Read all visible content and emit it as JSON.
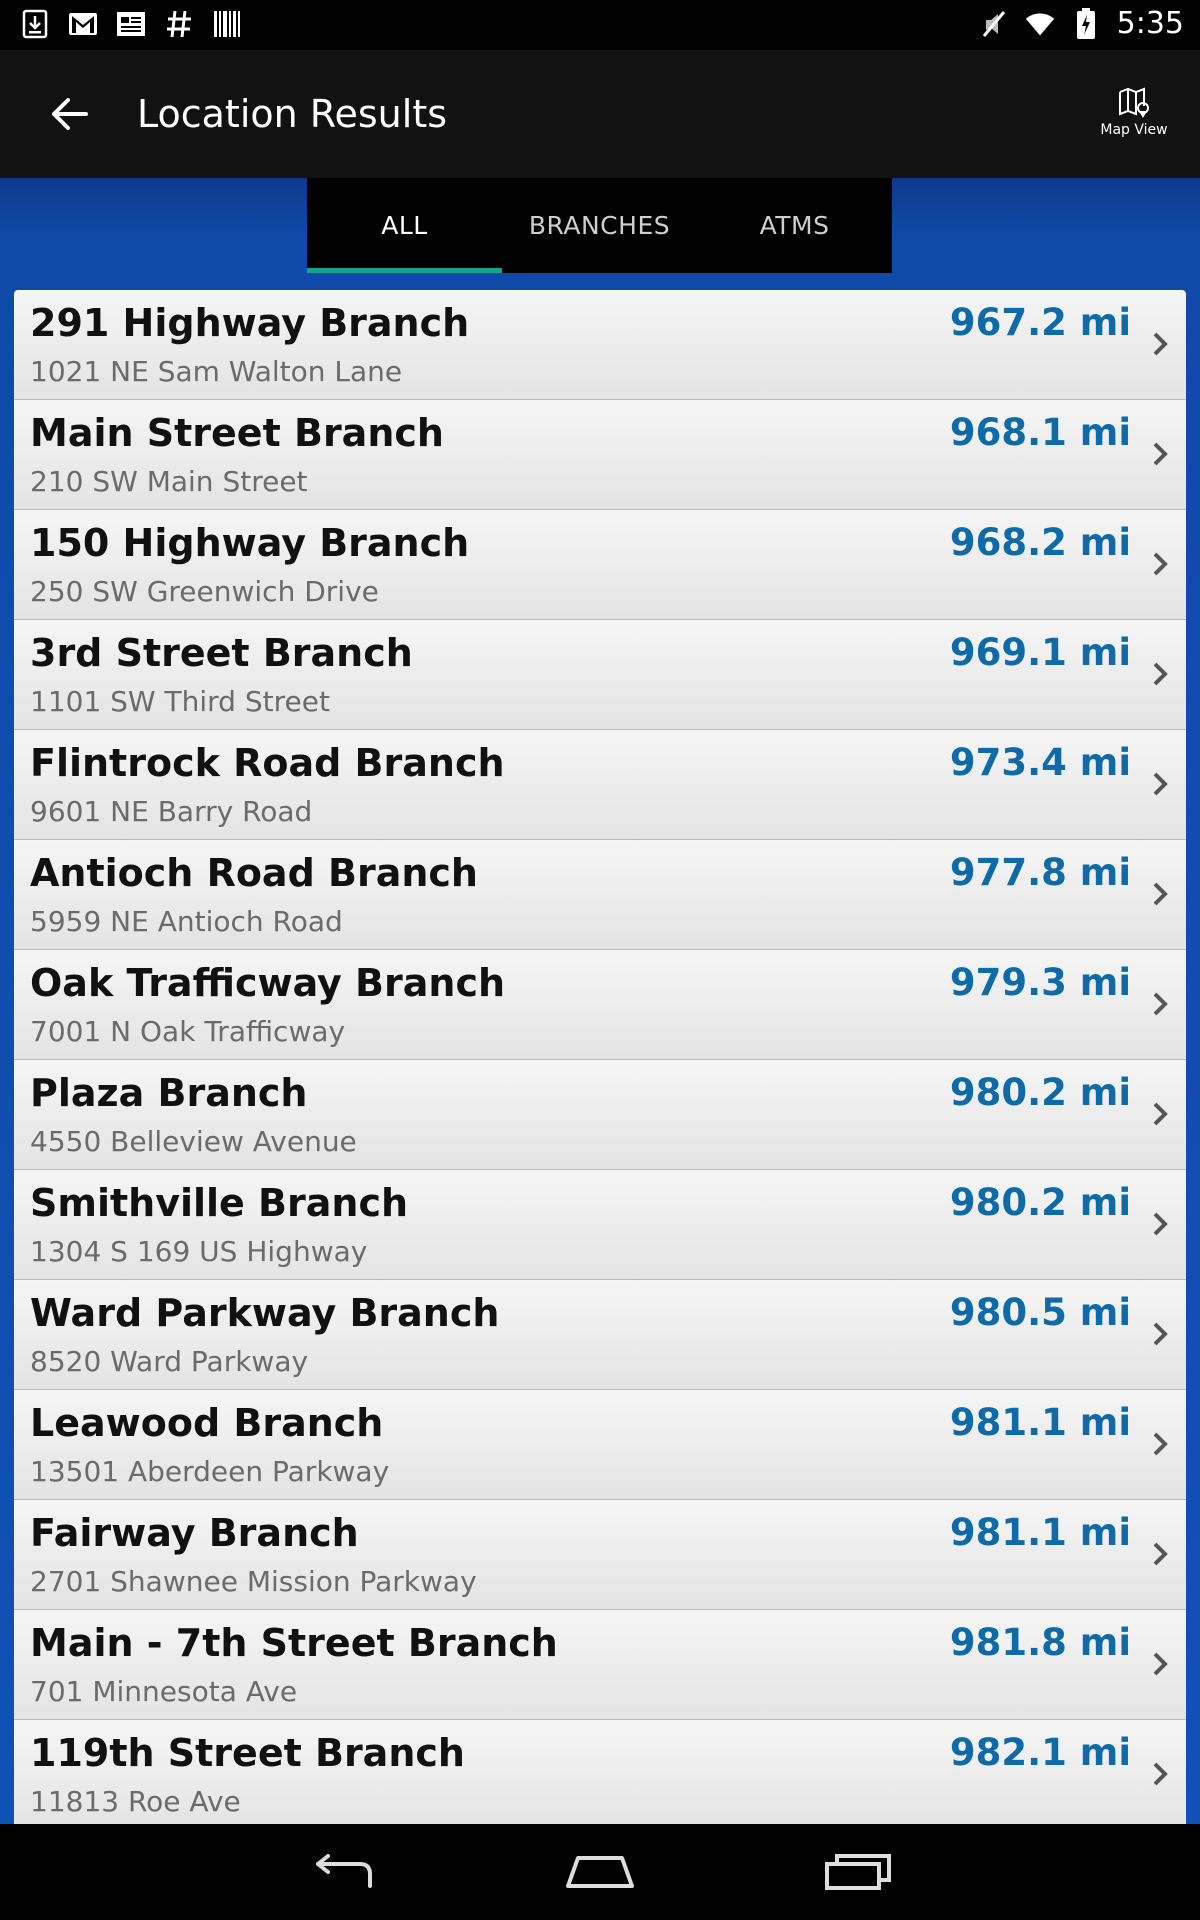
{
  "status_bar": {
    "left_icons": [
      "download-icon",
      "gmail-icon",
      "news-icon",
      "hash-icon",
      "barcode-icon"
    ],
    "right_icons": [
      "mute-icon",
      "wifi-icon",
      "battery-icon"
    ],
    "time": "5:35"
  },
  "app_bar": {
    "title": "Location Results",
    "map_view_label": "Map View"
  },
  "tabs": [
    {
      "label": "ALL",
      "active": true
    },
    {
      "label": "BRANCHES",
      "active": false
    },
    {
      "label": "ATMS",
      "active": false
    }
  ],
  "locations": [
    {
      "name": "291 Highway Branch",
      "address": "1021 NE Sam Walton Lane",
      "distance": "967.2 mi"
    },
    {
      "name": "Main Street Branch",
      "address": "210 SW Main Street",
      "distance": "968.1 mi"
    },
    {
      "name": "150 Highway Branch",
      "address": "250 SW Greenwich Drive",
      "distance": "968.2 mi"
    },
    {
      "name": "3rd Street Branch",
      "address": "1101 SW Third Street",
      "distance": "969.1 mi"
    },
    {
      "name": "Flintrock Road Branch",
      "address": "9601 NE Barry Road",
      "distance": "973.4 mi"
    },
    {
      "name": "Antioch Road Branch",
      "address": "5959 NE Antioch Road",
      "distance": "977.8 mi"
    },
    {
      "name": "Oak Trafficway Branch",
      "address": "7001 N Oak Trafficway",
      "distance": "979.3 mi"
    },
    {
      "name": "Plaza Branch",
      "address": "4550 Belleview Avenue",
      "distance": "980.2 mi"
    },
    {
      "name": "Smithville Branch",
      "address": "1304 S 169 US Highway",
      "distance": "980.2 mi"
    },
    {
      "name": "Ward Parkway Branch",
      "address": "8520 Ward Parkway",
      "distance": "980.5 mi"
    },
    {
      "name": "Leawood Branch",
      "address": "13501 Aberdeen Parkway",
      "distance": "981.1 mi"
    },
    {
      "name": "Fairway Branch",
      "address": "2701 Shawnee Mission Parkway",
      "distance": "981.1 mi"
    },
    {
      "name": "Main - 7th Street Branch",
      "address": "701 Minnesota Ave",
      "distance": "981.8 mi"
    },
    {
      "name": "119th Street Branch",
      "address": "11813 Roe Ave",
      "distance": "982.1 mi"
    }
  ],
  "nav_bar": [
    "back-nav-icon",
    "home-nav-icon",
    "recents-nav-icon"
  ],
  "colors": {
    "accent_tab_underline": "#14a38c",
    "distance_text": "#0f6aa8",
    "banner_blue": "#0f4aa8"
  }
}
